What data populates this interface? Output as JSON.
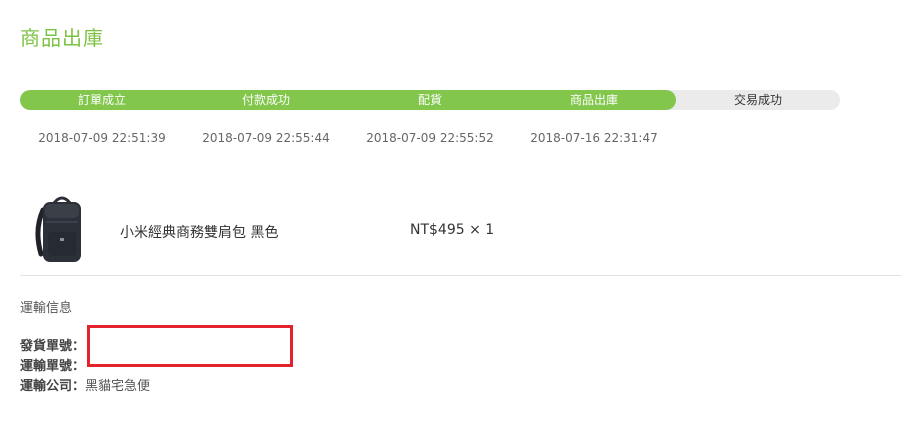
{
  "header": {
    "title": "商品出庫"
  },
  "progress": {
    "completed_steps": 4,
    "total_steps": 5,
    "colors": {
      "done": "#82c64c",
      "pending": "#ebebeb",
      "title": "#7cc242"
    },
    "steps": [
      {
        "label": "訂單成立",
        "status": "done"
      },
      {
        "label": "付款成功",
        "status": "done"
      },
      {
        "label": "配貨",
        "status": "done"
      },
      {
        "label": "商品出庫",
        "status": "done"
      },
      {
        "label": "交易成功",
        "status": "pending"
      }
    ],
    "timestamps": [
      "2018-07-09 22:51:39",
      "2018-07-09 22:55:44",
      "2018-07-09 22:55:52",
      "2018-07-16 22:31:47"
    ]
  },
  "order": {
    "items": [
      {
        "image_icon": "backpack-icon",
        "name": "小米經典商務雙肩包 黑色",
        "price_quantity": "NT$495 × 1"
      }
    ]
  },
  "shipping": {
    "heading": "運輸信息",
    "rows": [
      {
        "label": "發貨單號：",
        "value": ""
      },
      {
        "label": "運輸單號：",
        "value": ""
      },
      {
        "label": "運輸公司：",
        "value": "黑貓宅急便"
      }
    ],
    "redaction_color": "#e3232c"
  }
}
